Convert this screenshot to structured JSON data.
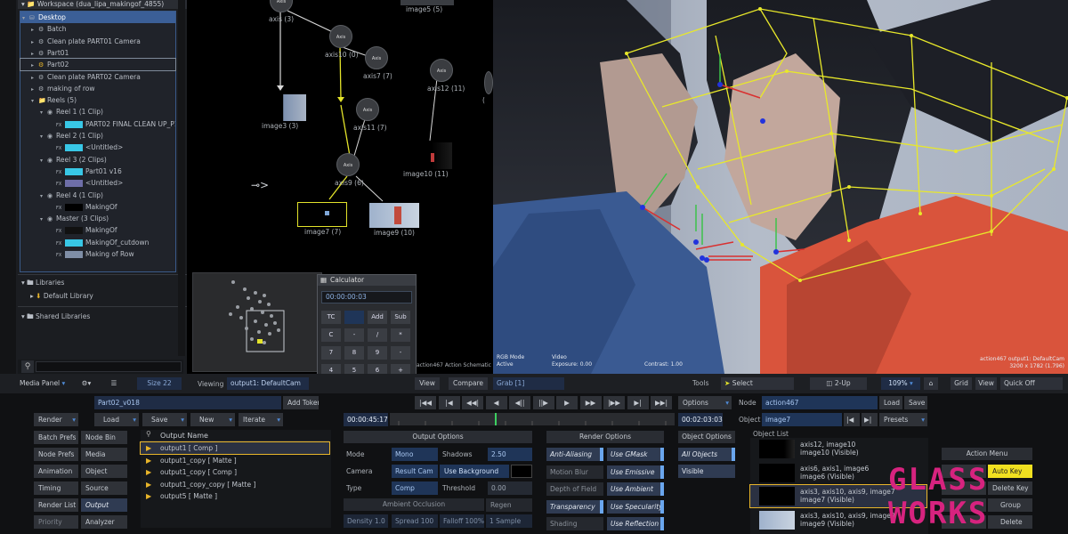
{
  "library": {
    "workspace_title": "Workspace (dua_lipa_makingof_4855)",
    "tree": [
      {
        "label": "Desktop",
        "indent": 0
      },
      {
        "label": "Batch",
        "indent": 1
      },
      {
        "label": "Clean plate PART01 Camera",
        "indent": 1
      },
      {
        "label": "Part01",
        "indent": 1
      },
      {
        "label": "Part02",
        "indent": 1
      },
      {
        "label": "Clean plate PART02 Camera",
        "indent": 1
      },
      {
        "label": "making of row",
        "indent": 1
      },
      {
        "label": "Reels (5)",
        "indent": 1
      },
      {
        "label": "Reel 1 (1 Clip)",
        "indent": 2
      },
      {
        "label": "PART02 FINAL CLEAN UP_P13_",
        "indent": 3
      },
      {
        "label": "Reel 2 (1 Clip)",
        "indent": 2
      },
      {
        "label": "<Untitled>",
        "indent": 3
      },
      {
        "label": "Reel 3 (2 Clips)",
        "indent": 2
      },
      {
        "label": "Part01 v16",
        "indent": 3
      },
      {
        "label": "<Untitled>",
        "indent": 3
      },
      {
        "label": "Reel 4 (1 Clip)",
        "indent": 2
      },
      {
        "label": "MakingOf",
        "indent": 3
      },
      {
        "label": "Master (3 Clips)",
        "indent": 2
      },
      {
        "label": "MakingOf",
        "indent": 3
      },
      {
        "label": "MakingOf_cutdown",
        "indent": 3
      },
      {
        "label": "Making of Row",
        "indent": 3
      }
    ],
    "libraries_label": "Libraries",
    "default_library_label": "Default Library",
    "shared_libraries_label": "Shared Libraries"
  },
  "schematic": {
    "nodes": [
      "axis (3)",
      "axis10 (0)",
      "axis7 (7)",
      "axis12 (11)",
      "axis11 (7)",
      "axis9 (6)"
    ],
    "node_badges": [
      "Axis",
      "Axis",
      "Axis",
      "Axis",
      "Axis",
      "Axis"
    ],
    "images": [
      "image5 (5)",
      "image3 (3)",
      "image10 (11)",
      "image7 (7)",
      "image9 (10)"
    ],
    "status_caption": "action467 Action Schematic"
  },
  "calculator": {
    "title": "Calculator",
    "display": "00:00:00:03",
    "keys": [
      "TC",
      "",
      "Add",
      "Sub",
      "C",
      "-",
      "/",
      "*",
      "7",
      "8",
      "9",
      "-",
      "4",
      "5",
      "6",
      "+",
      "1",
      "2",
      "3",
      "Enter",
      "0",
      "."
    ]
  },
  "viewer": {
    "mode_label": "RGB Mode",
    "mode_value": "Active",
    "video_label": "Video",
    "exposure": "Exposure: 0.00",
    "contrast": "Contrast: 1.00",
    "camera_caption": "action467 output1: DefaultCam",
    "resolution": "3200 x 1782 (1.796)"
  },
  "viewbar": {
    "media_panel": "Media Panel",
    "size_field": "Size 22",
    "viewing_label": "Viewing",
    "viewing_value": "output1: DefaultCam",
    "view_btn": "View",
    "compare_btn": "Compare",
    "grab_field": "Grab [1]",
    "tools_label": "Tools",
    "select_btn": "Select",
    "twoup_btn": "2-Up",
    "zoom_value": "109%",
    "grid_btn": "Grid",
    "view2_btn": "View",
    "quickoff_btn": "Quick Off"
  },
  "bottom": {
    "setup_name": "Part02_v018",
    "add_token": "Add Token",
    "render_btn": "Render",
    "load_btn": "Load",
    "save_btn": "Save",
    "new_btn": "New",
    "iterate_btn": "Iterate",
    "left_buttons": [
      "Batch Prefs",
      "Node Bin",
      "Node Prefs",
      "Media",
      "Animation",
      "Object",
      "Timing",
      "Source",
      "Render List",
      "Output",
      "Priority",
      "Analyzer"
    ],
    "output_header": "Output Name",
    "outputs": [
      "output1 [ Comp ]",
      "output1_copy [ Matte ]",
      "output1_copy [ Comp ]",
      "output1_copy_copy [ Matte ]",
      "output5 [ Matte ]"
    ],
    "timecode_current": "00:00:45:17",
    "timecode_end": "00:02:03:03",
    "output_options_header": "Output Options",
    "mode_label": "Mode",
    "mode_value": "Mono",
    "shadows_label": "Shadows",
    "shadows_value": "2.50",
    "camera_label": "Camera",
    "camera_value": "Result Cam",
    "use_background": "Use Background",
    "type_label": "Type",
    "type_value": "Comp",
    "threshold_label": "Threshold",
    "threshold_value": "0.00",
    "ambient_occlusion": "Ambient Occlusion",
    "regen": "Regen",
    "density": "Density 1.0",
    "spread": "Spread 100",
    "falloff": "Falloff 100%",
    "sample": "1 Sample",
    "render_options_header": "Render Options",
    "render_toggles_left": [
      "Anti-Aliasing",
      "Motion Blur",
      "Depth of Field",
      "Transparency",
      "Shading"
    ],
    "render_toggles_right": [
      "Use GMask",
      "Use Emissive",
      "Use Ambient",
      "Use Specularity",
      "Use Reflection"
    ],
    "object_options_header": "Object Options",
    "all_objects": "All Objects",
    "visible": "Visible",
    "node_label": "Node",
    "node_value": "action467",
    "object_label": "Object",
    "object_value": "image7",
    "options_btn": "Options",
    "load2_btn": "Load",
    "save2_btn": "Save",
    "presets_btn": "Presets",
    "object_list_label": "Object List",
    "objects": [
      {
        "line1": "axis12, image10",
        "line2": "image10 (Visible)"
      },
      {
        "line1": "axis6, axis1, image6",
        "line2": "image6 (Visible)"
      },
      {
        "line1": "axis3, axis10, axis9, image7",
        "line2": "image7 (Visible)"
      },
      {
        "line1": "axis3, axis10, axis9, image9",
        "line2": "image9 (Visible)"
      }
    ],
    "action_menu": "Action Menu",
    "auto_key": "Auto Key",
    "delete_key": "Delete Key",
    "group_btn": "Group",
    "delete_btn": "Delete"
  },
  "watermark": {
    "line1": "GLASS",
    "line2": "WORKS"
  },
  "colors": {
    "accent": "#4f8ad6",
    "selection": "#3b5f97",
    "link_yellow": "#e3e32a",
    "watermark": "#d7237f",
    "skirt": "#e3543a"
  }
}
